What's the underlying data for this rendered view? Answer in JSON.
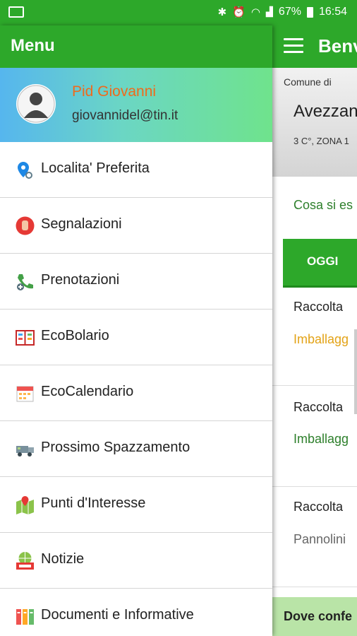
{
  "status_bar": {
    "time": "16:54",
    "battery": "67%",
    "icons": [
      "bluetooth-icon",
      "alarm-icon",
      "wifi-icon",
      "signal-icon",
      "battery-icon",
      "photo-icon"
    ]
  },
  "drawer": {
    "title": "Menu",
    "profile": {
      "name": "Pid Giovanni",
      "email": "giovannidel@tin.it"
    },
    "items": [
      {
        "label": "Localita' Preferita",
        "icon": "map-pin-search-icon"
      },
      {
        "label": "Segnalazioni",
        "icon": "stop-hand-icon"
      },
      {
        "label": "Prenotazioni",
        "icon": "phone-add-icon"
      },
      {
        "label": "EcoBolario",
        "icon": "dictionary-icon"
      },
      {
        "label": "EcoCalendario",
        "icon": "calendar-icon"
      },
      {
        "label": "Prossimo Spazzamento",
        "icon": "street-sweeper-icon"
      },
      {
        "label": "Punti d'Interesse",
        "icon": "map-icon"
      },
      {
        "label": "Notizie",
        "icon": "news-icon"
      },
      {
        "label": "Documenti e Informative",
        "icon": "documents-icon"
      }
    ]
  },
  "main": {
    "title": "Benv",
    "comune_label": "Comune di",
    "city": "Avezzan",
    "zone": "3 C°, ZONA 1",
    "question": "Cosa si es",
    "tab_today": "OGGI",
    "cards": [
      {
        "heading": "Raccolta",
        "sub": "Imballagg",
        "sub_color": "#e3a317"
      },
      {
        "heading": "Raccolta",
        "sub": "Imballagg",
        "sub_color": "#2d7f2b"
      },
      {
        "heading": "Raccolta",
        "sub": "Pannolini",
        "sub_color": "#666666"
      }
    ],
    "bottom_label": "Dove confe"
  },
  "colors": {
    "primary": "#2da82a",
    "accent_orange": "#ef6a1c"
  }
}
